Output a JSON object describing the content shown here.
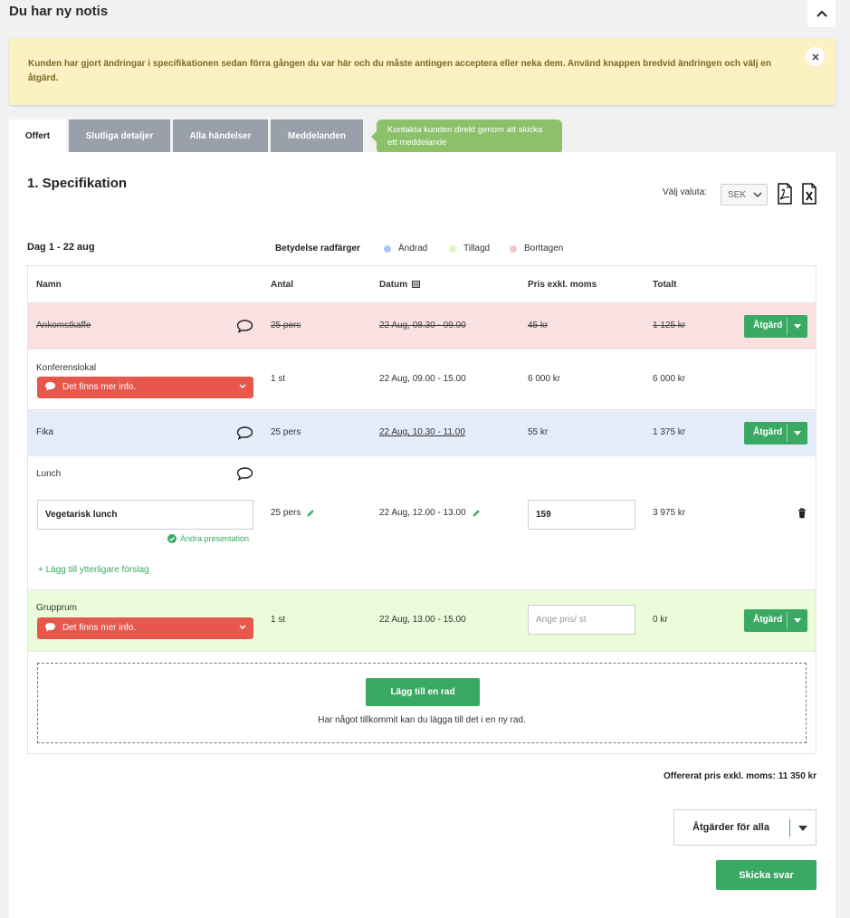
{
  "notification": {
    "title": "Du har ny notis",
    "message": "Kunden har gjort ändringar i specifikationen sedan förra gången du var här och du måste antingen acceptera eller neka dem. Använd knappen bredvid ändringen och välj en åtgärd."
  },
  "tabs": [
    {
      "label": "Offert"
    },
    {
      "label": "Slutliga detaljer"
    },
    {
      "label": "Alla händelser"
    },
    {
      "label": "Meddelanden"
    }
  ],
  "tooltip": {
    "text": "Kontakta kunden direkt genom att skicka ett meddelande"
  },
  "spec": {
    "title": "1. Specifikation",
    "currency_label": "Välj valuta:",
    "currency_value": "SEK"
  },
  "day": {
    "title": "Dag 1 - 22 aug"
  },
  "legend": {
    "label": "Betydelse radfärger",
    "items": [
      {
        "label": "Ändrad",
        "color": "#a9c4f2"
      },
      {
        "label": "Tillagd",
        "color": "#ddf8c7"
      },
      {
        "label": "Borttagen",
        "color": "#f3c7c7"
      }
    ]
  },
  "table": {
    "headers": {
      "name": "Namn",
      "qty": "Antal",
      "date": "Datum",
      "price": "Pris exkl. moms",
      "total": "Totalt"
    },
    "rows": [
      {
        "name": "Ankomstkaffe",
        "qty": "25 pers",
        "date": "22 Aug, 08.30 - 09.00",
        "price": "45 kr",
        "total": "1 125 kr",
        "action": "Åtgärd",
        "state": "removed"
      },
      {
        "name": "Konferenslokal",
        "info": "Det finns mer info.",
        "qty": "1 st",
        "date": "22 Aug, 09.00 - 15.00",
        "price": "6 000 kr",
        "total": "6 000 kr",
        "state": "normal"
      },
      {
        "name": "Fika",
        "qty": "25 pers",
        "date": "22 Aug, 10.30 - 11.00",
        "price": "55 kr",
        "total": "1 375 kr",
        "action": "Åtgärd",
        "state": "changed"
      },
      {
        "name": "Lunch",
        "selection": "Vegetarisk lunch",
        "change_presentation": "Ändra presentation",
        "add_suggestion": "+ Lägg till ytterligare förslag",
        "qty": "25 pers",
        "date": "22 Aug, 12.00 - 13.00",
        "price": "159",
        "total": "3 975 kr",
        "state": "normal"
      },
      {
        "name": "Grupprum",
        "info": "Det finns mer info.",
        "qty": "1 st",
        "date": "22 Aug, 13.00 - 15.00",
        "price_placeholder": "Ange pris/ st",
        "total": "0 kr",
        "action": "Åtgärd",
        "state": "added"
      }
    ]
  },
  "add_row": {
    "button": "Lägg till en rad",
    "help": "Har något tillkommit kan du lägga till det i en ny rad."
  },
  "total": {
    "text": "Offererat pris exkl. moms: 11 350 kr"
  },
  "actions": {
    "all_label": "Åtgärder för alla",
    "send_label": "Skicka svar"
  },
  "colors": {
    "accent_green": "#3aa963",
    "removed_bg": "#f9e1e1",
    "changed_bg": "#e5ecf9",
    "added_bg": "#eafcda",
    "info_red": "#e8574b"
  }
}
